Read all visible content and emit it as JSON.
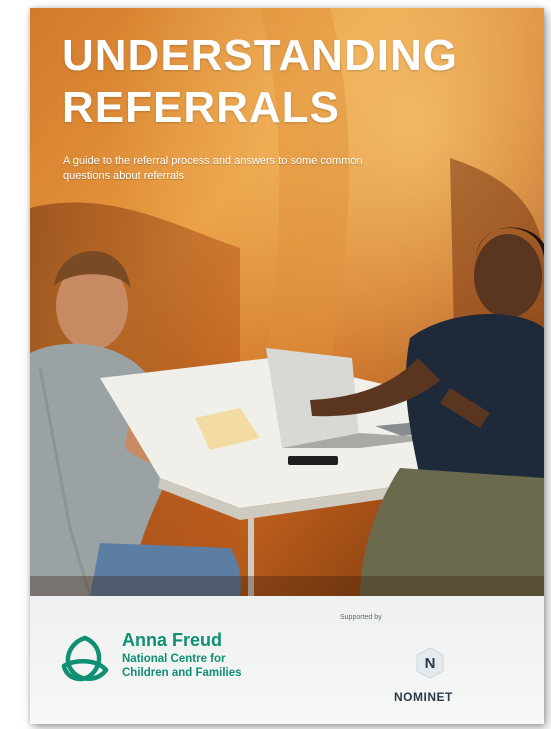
{
  "cover": {
    "title_line1": "UNDERSTANDING",
    "title_line2": "REFERRALS",
    "subtitle": "A guide to the referral process and answers to some common questions about referrals"
  },
  "footer": {
    "org_name": "Anna Freud",
    "org_subtitle_line1": "National Centre for",
    "org_subtitle_line2": "Children and Families",
    "supported_by": "Supported by",
    "sponsor_wordmark": "NOMINET",
    "sponsor_letter": "N"
  },
  "colors": {
    "brand_green": "#0f8f73",
    "photo_orange": "#c86a22",
    "footer_bg": "#eef1f0"
  },
  "icons": [
    "anna-freud-logo-icon",
    "nominet-logo-icon"
  ]
}
